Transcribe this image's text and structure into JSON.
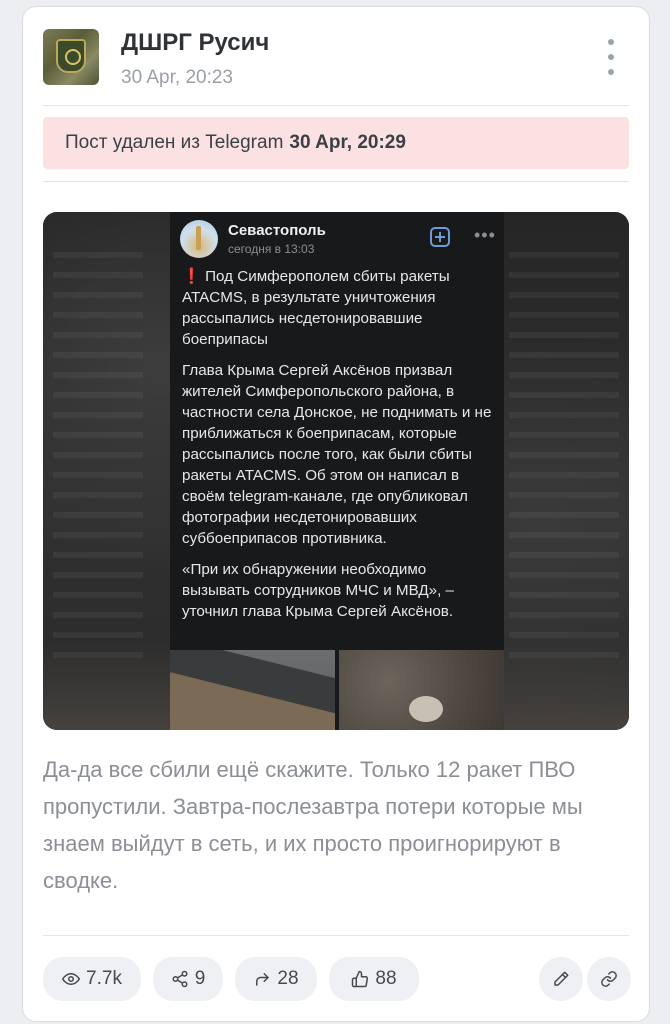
{
  "post": {
    "channel_name": "ДШРГ Русич",
    "time": "30 Apr, 20:23",
    "deleted_notice": {
      "text": "Пост удален из Telegram",
      "datetime": "30 Apr, 20:29"
    },
    "embedded_screenshot": {
      "author": "Севастополь",
      "time": "сегодня в 13:03",
      "headline_mark": "❗",
      "headline": " Под Симферополем сбиты ракеты ATACMS, в результате уничтожения рассыпались несдетонировавшие боеприпасы",
      "paragraph_1": "Глава Крыма Сергей Аксёнов призвал жителей Симферопольского района, в частности села Донское, не поднимать и не приближаться к боеприпасам, которые рассыпались после того, как были сбиты ракеты ATACMS. Об этом он написал в своём telegram-канале, где опубликовал фотографии несдетонировавших суббоеприпасов противника.",
      "paragraph_2": "«При их обнаружении необходимо вызывать сотрудников МЧС и МВД», – уточнил глава Крыма Сергей Аксёнов."
    },
    "text": "Да-да все сбили ещё скажите. Только 12 ракет ПВО пропустили. Завтра-послезавтра потери которые мы знаем выйдут в сеть, и их просто проигнорируют в сводке."
  },
  "stats": {
    "views": "7.7k",
    "reposts": "9",
    "shares": "28",
    "likes": "88"
  },
  "colors": {
    "banner_bg": "#fbe1e2",
    "card_bg": "#ffffff",
    "stat_bg": "#eef0f3",
    "accent": "#6d9ad8"
  },
  "icons": {
    "views": "eye-icon",
    "reposts": "share-nodes-icon",
    "shares": "forward-arrow-icon",
    "likes": "thumbs-up-icon",
    "edit": "pencil-icon",
    "link": "link-icon",
    "more": "vertical-dots-icon"
  }
}
